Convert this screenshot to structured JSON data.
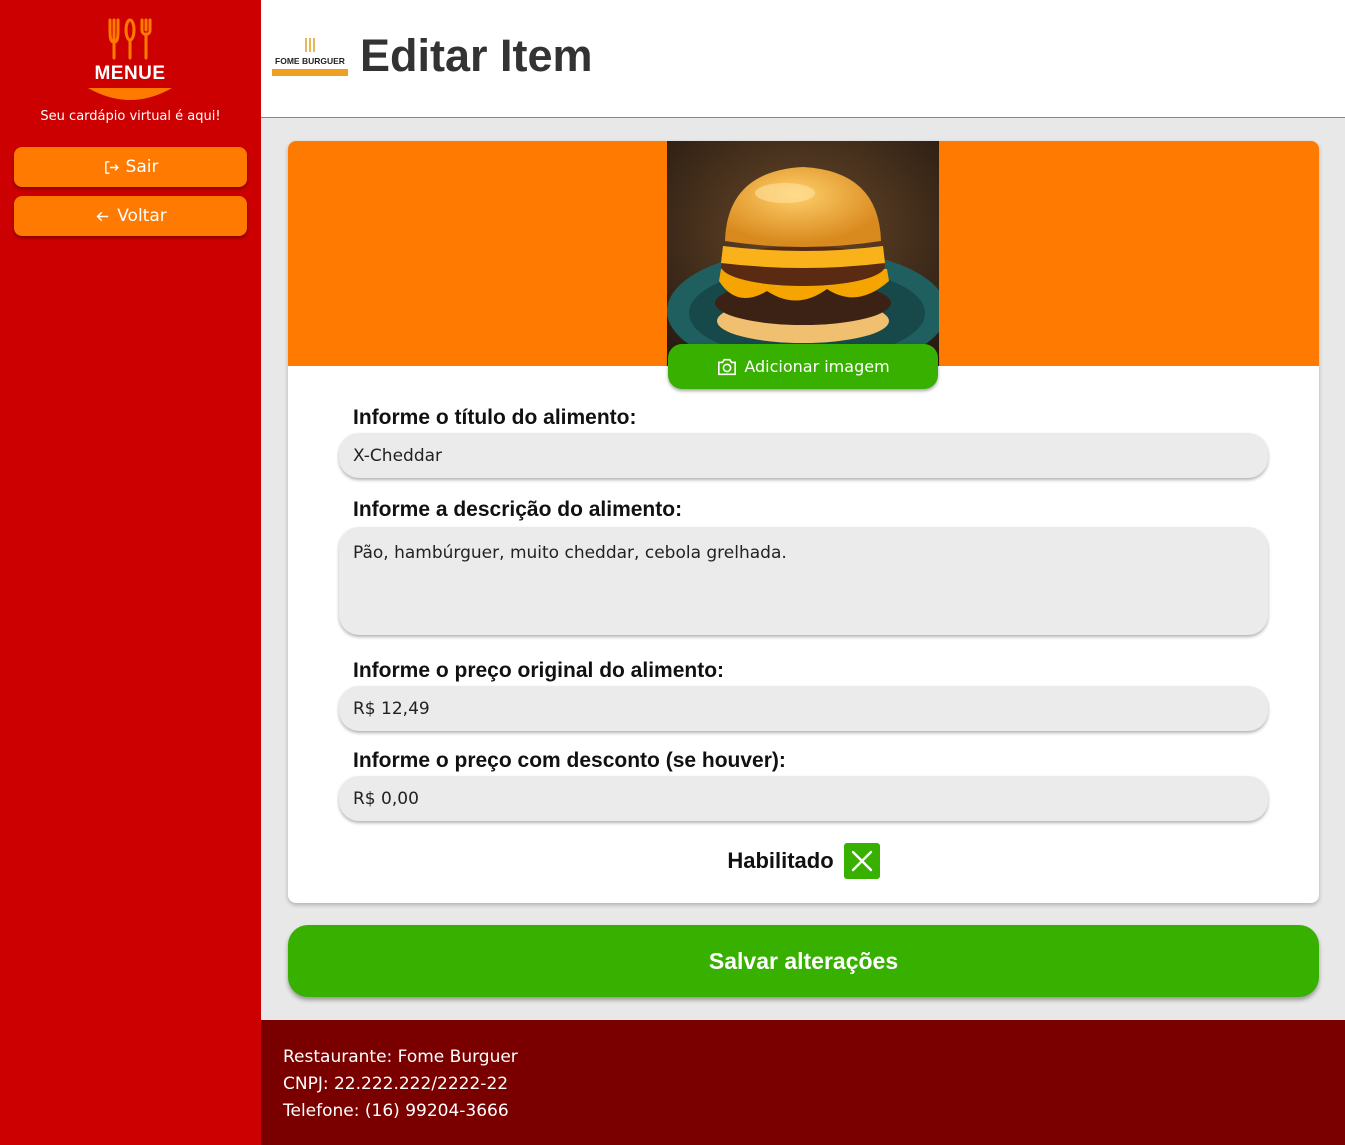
{
  "sidebar": {
    "logo_text": "MENUE",
    "tagline": "Seu cardápio virtual é aqui!",
    "exit_label": "Sair",
    "back_label": "Voltar"
  },
  "header": {
    "brand_text": "FOME BURGUER",
    "title": "Editar Item"
  },
  "form": {
    "add_image_label": "Adicionar imagem",
    "title_label": "Informe o título do alimento:",
    "title_value": "X-Cheddar",
    "description_label": "Informe a descrição do alimento:",
    "description_value": "Pão, hambúrguer, muito cheddar, cebola grelhada.",
    "price_label": "Informe o preço original do alimento:",
    "price_value": "R$ 12,49",
    "discount_label": "Informe o preço com desconto (se houver):",
    "discount_value": "R$ 0,00",
    "enabled_label": "Habilitado",
    "enabled": true,
    "save_label": "Salvar alterações"
  },
  "footer": {
    "restaurant": "Restaurante: Fome Burguer",
    "cnpj": "CNPJ: 22.222.222/2222-22",
    "phone": "Telefone: (16) 99204-3666"
  },
  "colors": {
    "sidebar_red": "#cc0000",
    "accent_orange": "#ff7a00",
    "action_green": "#37b000",
    "footer_darkred": "#7a0000"
  },
  "icons": {
    "exit": "logout-icon",
    "back": "arrow-left-icon",
    "camera": "camera-icon",
    "check": "x-mark-icon"
  }
}
